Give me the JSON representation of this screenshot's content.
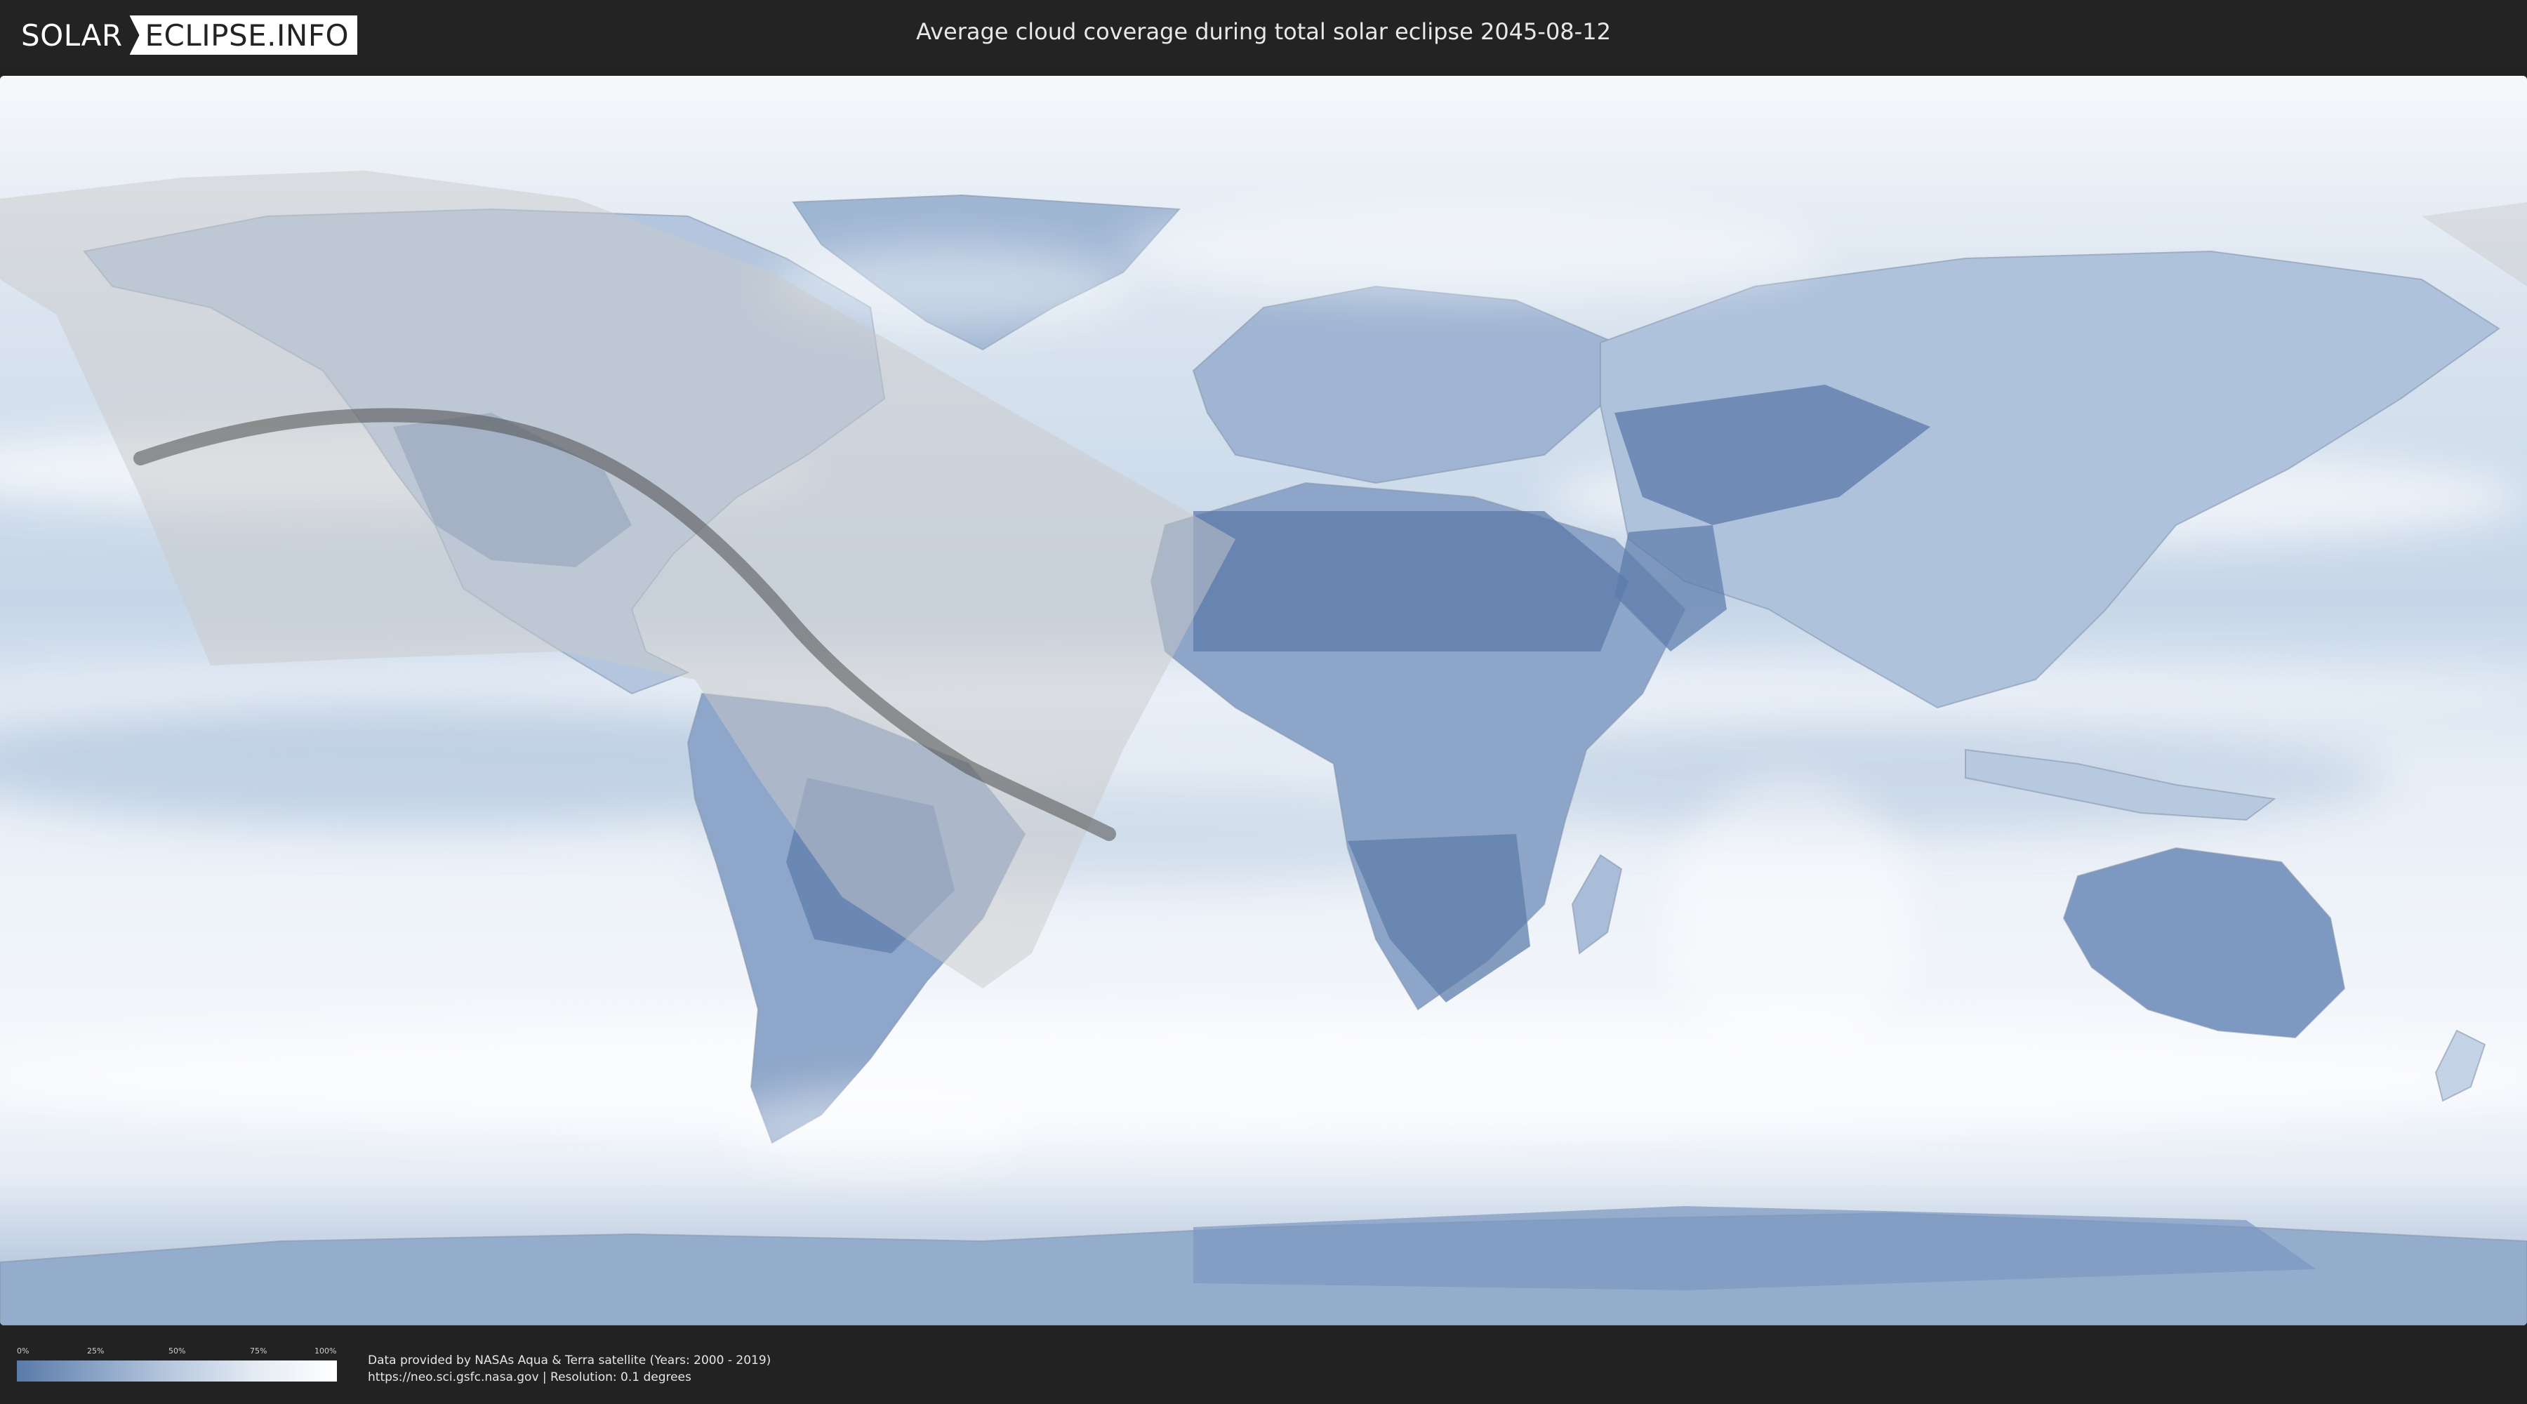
{
  "header": {
    "logo_solar": "SOLAR",
    "logo_eclipse": "ECLIPSE.INFO",
    "title": "Average cloud coverage during total solar eclipse 2045-08-12"
  },
  "map": {
    "description_colors": {
      "land_clear": "#5b7aa8",
      "cloudy": "#ffffff",
      "ocean_mid": "#c9d8ea",
      "eclipse_shade": "#bdbdbd",
      "central_line": "#555555"
    }
  },
  "legend": {
    "ticks": [
      "0%",
      "25%",
      "50%",
      "75%",
      "100%"
    ]
  },
  "footer": {
    "line1": "Data provided by NASAs Aqua & Terra satellite (Years: 2000 - 2019)",
    "line2": "https://neo.sci.gsfc.nasa.gov | Resolution: 0.1 degrees"
  }
}
